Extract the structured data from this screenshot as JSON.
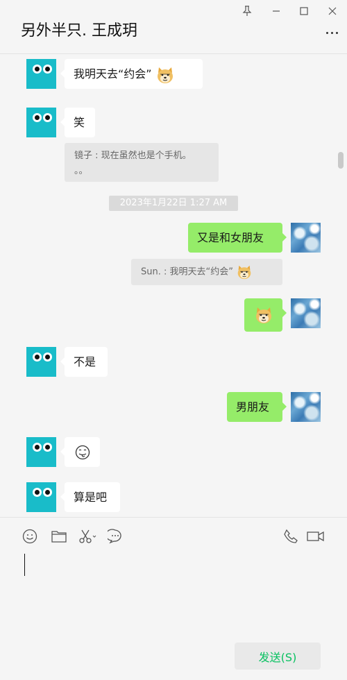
{
  "window": {
    "title": "另外半只. 王成玥",
    "controls": [
      "pin-icon",
      "minimize-icon",
      "maximize-icon",
      "close-icon"
    ]
  },
  "messages": [
    {
      "side": "left",
      "text": "我明天去“约会”",
      "emoji": "doge"
    },
    {
      "side": "left",
      "text": "笑",
      "quote": "镜子 : 现在虽然也是个手机。。。"
    },
    {
      "timestamp": "2023年1月22日 1:27 AM"
    },
    {
      "side": "right",
      "text": "又是和女朋友",
      "quote": "Sun. : 我明天去“约会”",
      "quote_emoji": "doge"
    },
    {
      "side": "right",
      "emoji": "doge"
    },
    {
      "side": "left",
      "text": "不是"
    },
    {
      "side": "right",
      "text": "男朋友"
    },
    {
      "side": "left",
      "emoji": "tongue-face"
    },
    {
      "side": "left",
      "text": "算是吧"
    }
  ],
  "quotes": {
    "q1_line1": "镜子 : 现在虽然也是个手机。",
    "q1_line2": "。。",
    "q2": "Sun. : 我明天去“约会”"
  },
  "toolbar": {
    "icons": [
      "emoji-icon",
      "folder-icon",
      "scissors-icon",
      "chat-history-icon",
      "phone-icon",
      "video-call-icon"
    ]
  },
  "composer": {
    "send_label": "发送(S)"
  },
  "colors": {
    "accent": "#07c160",
    "outgoing_bubble": "#95ec69",
    "incoming_bubble": "#ffffff",
    "avatar_teal": "#19bcc9"
  }
}
